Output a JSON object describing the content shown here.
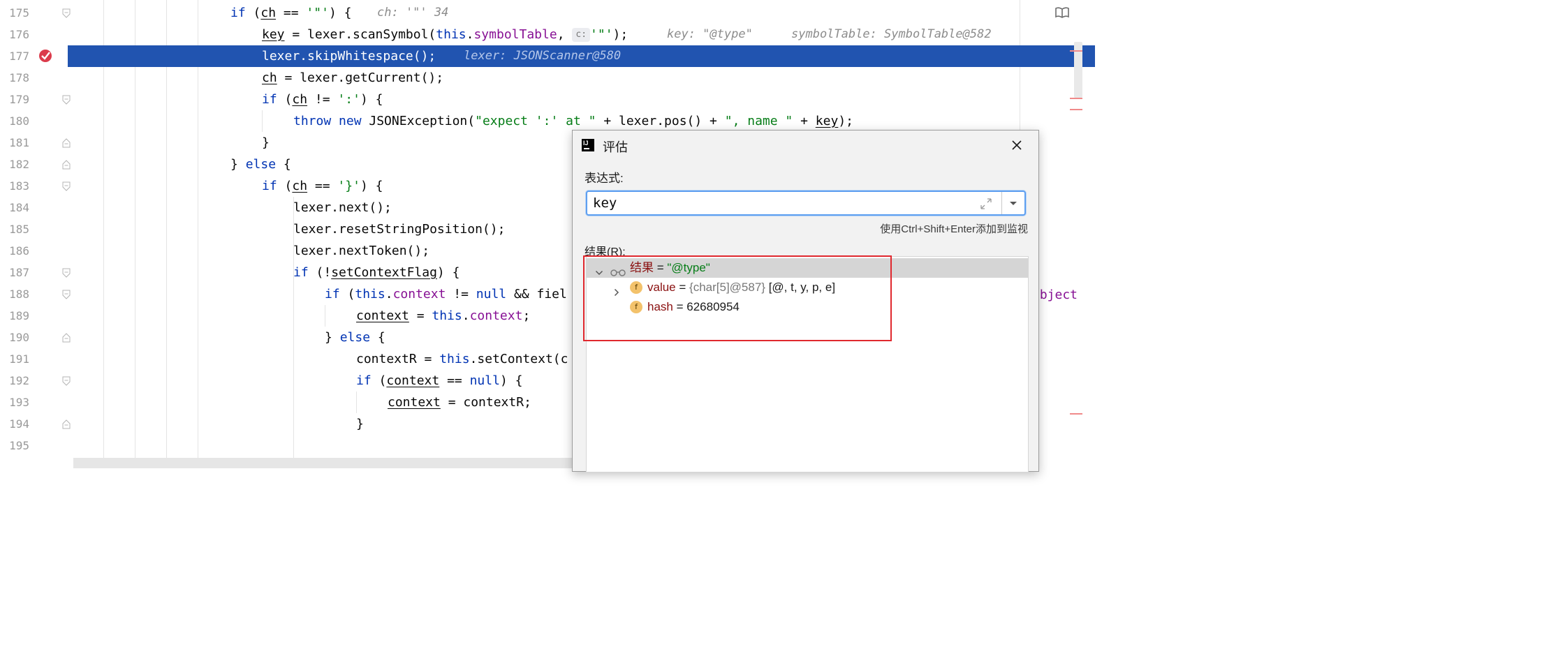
{
  "editor": {
    "line_numbers": [
      "175",
      "176",
      "177",
      "178",
      "179",
      "180",
      "181",
      "182",
      "183",
      "184",
      "185",
      "186",
      "187",
      "188",
      "189",
      "190",
      "191",
      "192",
      "193",
      "194",
      "195"
    ],
    "line175": {
      "kw_if": "if",
      "open": " (",
      "ch": "ch",
      "mid": " == ",
      "lit": "'\"'",
      "close": ") {",
      "hint": "ch: '\"' 34"
    },
    "line176": {
      "key": "key",
      "eq": " = lexer.scanSymbol(",
      "this": "this",
      "dot": ".",
      "symbolTable": "symbolTable",
      "comma": ", ",
      "inlay": "c:",
      "lit": "'\"'",
      "end": ");",
      "hint1": "key: \"@type\"",
      "hint2": "symbolTable: SymbolTable@582"
    },
    "line177": {
      "code": "lexer.skipWhitespace();",
      "hint": "lexer: JSONScanner@580"
    },
    "line178": {
      "ch": "ch",
      "rest": " = lexer.getCurrent();"
    },
    "line179": {
      "kw_if": "if",
      "open": " (",
      "ch": "ch",
      "mid": " != ",
      "lit": "':'",
      "close": ") {"
    },
    "line180": {
      "kw_throw": "throw",
      "sp": " ",
      "kw_new": "new",
      "mid": " JSONException(",
      "lit1": "\"expect ':' at \"",
      "mid2": " + lexer.pos() + ",
      "lit2": "\", name \"",
      "mid3": " + ",
      "key": "key",
      "end": ");"
    },
    "line181": {
      "code": "}"
    },
    "line182": {
      "brace": "} ",
      "kw_else": "else",
      "end": " {"
    },
    "line183": {
      "kw_if": "if",
      "open": " (",
      "ch": "ch",
      "mid": " == ",
      "lit": "'}'",
      "close": ") {"
    },
    "line184": {
      "code": "lexer.next();"
    },
    "line185": {
      "code": "lexer.resetStringPosition();"
    },
    "line186": {
      "code": "lexer.nextToken();"
    },
    "line187": {
      "kw_if": "if",
      "open": " (!",
      "flag": "setContextFlag",
      "close": ") {"
    },
    "line188": {
      "kw_if": "if",
      "open": " (",
      "this": "this",
      "dot": ".",
      "context": "context",
      "mid": " != ",
      "kw_null": "null",
      "rest": " && fiel"
    },
    "line189": {
      "context": "context",
      "mid": " = ",
      "this": "this",
      "dot": ".",
      "field": "context",
      "end": ";"
    },
    "line190": {
      "brace": "} ",
      "kw_else": "else",
      "end": " {"
    },
    "line191": {
      "code1": "contextR = ",
      "this": "this",
      "code2": ".setContext(c"
    },
    "line192": {
      "kw_if": "if",
      "open": " (",
      "context": "context",
      "mid": " == ",
      "kw_null": "null",
      "close": ") {"
    },
    "line193": {
      "context": "context",
      "rest": " = contextR;"
    },
    "line194": {
      "code": "}"
    },
    "line195": {
      "code": ""
    },
    "clipped_right": "object"
  },
  "dialog": {
    "title": "评估",
    "expression_label": "表达式:",
    "expression_value": "key",
    "add_watch_hint": "使用Ctrl+Shift+Enter添加到监视",
    "result_label": "结果(R):",
    "result_root": {
      "name": "结果",
      "eq": " = ",
      "value": "\"@type\""
    },
    "fields": [
      {
        "icon": "f",
        "name": "value",
        "eq": " = ",
        "type": "{char[5]@587}",
        "value": " [@, t, y, p, e]"
      },
      {
        "icon": "f",
        "name": "hash",
        "eq": " = ",
        "type": "",
        "value": "62680954"
      }
    ]
  },
  "colors": {
    "highlight_line": "#2154b0",
    "keyword": "#0033b3",
    "field": "#871094",
    "string": "#067d17",
    "annotation_box": "#e0282e"
  }
}
